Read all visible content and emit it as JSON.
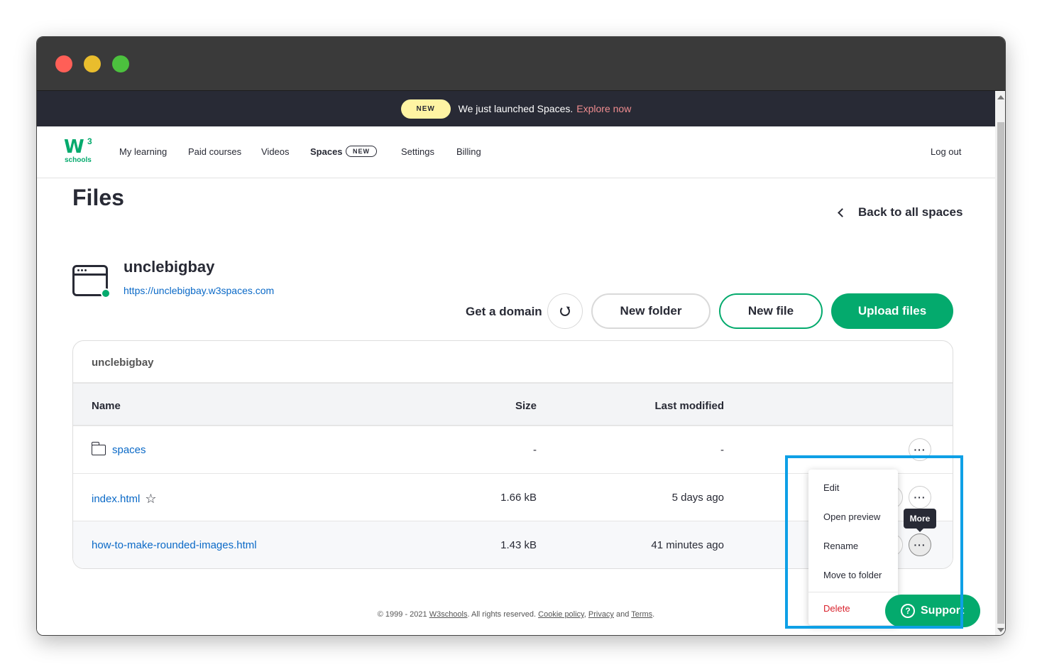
{
  "banner": {
    "badge": "NEW",
    "text": "We just launched Spaces.",
    "link": "Explore now"
  },
  "logo": {
    "mark": "W",
    "sup": "3",
    "word": "schools"
  },
  "nav": {
    "items": [
      "My learning",
      "Paid courses",
      "Videos",
      "Spaces",
      "Settings",
      "Billing"
    ],
    "spaces_badge": "NEW",
    "logout": "Log out"
  },
  "page": {
    "title": "Files",
    "back": "Back to all spaces"
  },
  "space": {
    "name": "unclebigbay",
    "url": "https://unclebigbay.w3spaces.com"
  },
  "actions": {
    "get_domain": "Get a domain",
    "new_folder": "New folder",
    "new_file": "New file",
    "upload": "Upload files"
  },
  "table": {
    "breadcrumb": "unclebigbay",
    "headers": {
      "name": "Name",
      "size": "Size",
      "modified": "Last modified"
    },
    "rows": [
      {
        "name": "spaces",
        "type": "folder",
        "size": "-",
        "modified": "-"
      },
      {
        "name": "index.html",
        "type": "file",
        "starred": false,
        "size": "1.66 kB",
        "modified": "5 days ago"
      },
      {
        "name": "how-to-make-rounded-images.html",
        "type": "file",
        "size": "1.43 kB",
        "modified": "41 minutes ago"
      }
    ],
    "more_glyph": "···"
  },
  "menu": {
    "items": [
      "Edit",
      "Open preview",
      "Rename",
      "Move to folder"
    ],
    "delete": "Delete",
    "tooltip": "More"
  },
  "support": {
    "label": "Support",
    "icon": "?"
  },
  "footer": {
    "prefix": "© 1999 - 2021 ",
    "brand": "W3schools",
    "mid": ". All rights reserved. ",
    "cookie": "Cookie policy",
    "comma": ", ",
    "privacy": "Privacy",
    "and": " and ",
    "terms": "Terms",
    "end": "."
  },
  "colors": {
    "accent": "#04aa6d",
    "link": "#0a69c7",
    "dark": "#282a35",
    "highlight": "#0ea0e6",
    "danger": "#d9212c"
  }
}
